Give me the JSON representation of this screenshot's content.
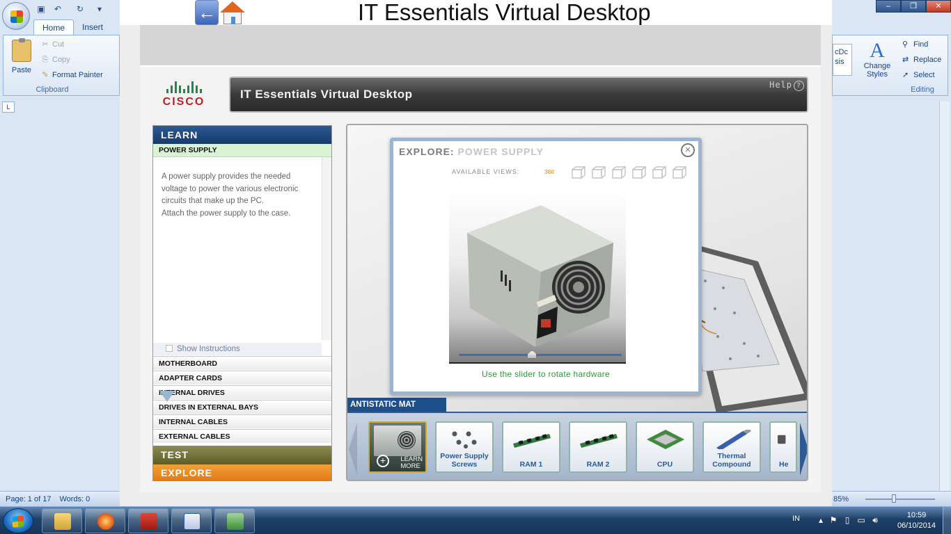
{
  "word": {
    "tabs": [
      "Home",
      "Insert"
    ],
    "paste_label": "Paste",
    "cut_label": "Cut",
    "copy_label": "Copy",
    "format_painter_label": "Format Painter",
    "clipboard_label": "Clipboard",
    "styles_frag_1": "C",
    "styles_frag_2": "I",
    "styles_text_1": "cDc",
    "styles_text_2": "sis",
    "change_styles_label": "Change Styles",
    "find_label": "Find",
    "replace_label": "Replace",
    "select_label": "Select",
    "editing_label": "Editing",
    "ruler_label": "L",
    "status_page": "Page: 1 of 17",
    "status_words": "Words: 0",
    "zoom_level": "85%",
    "window_controls": [
      "–",
      "❐",
      "✕"
    ]
  },
  "app": {
    "window_title": "IT Essentials Virtual Desktop",
    "header_title": "IT Essentials Virtual Desktop",
    "help_label": "Help",
    "cisco_wordmark": "CISCO",
    "learn_label": "LEARN",
    "selected_item": "POWER SUPPLY",
    "description": [
      "A power supply provides the needed",
      "voltage to power the various electronic",
      "circuits that make up the PC.",
      "Attach the power supply to the case."
    ],
    "show_instructions": "Show Instructions",
    "categories": [
      "MOTHERBOARD",
      "ADAPTER CARDS",
      "INTERNAL DRIVES",
      "DRIVES IN EXTERNAL BAYS",
      "INTERNAL CABLES",
      "EXTERNAL CABLES"
    ],
    "test_label": "TEST",
    "explore_label": "EXPLORE",
    "antistatic_label": "ANTISTATIC MAT"
  },
  "popup": {
    "title_a": "EXPLORE:",
    "title_b": "POWER SUPPLY",
    "close_glyph": "×",
    "available_views_label": "AVAILABLE VIEWS:",
    "rotate_label": "360",
    "slider_hint": "Use the slider to rotate hardware",
    "rotation_value": 0.45
  },
  "tray": {
    "items": [
      {
        "label": "LEARN MORE",
        "icon": "power-supply-icon"
      },
      {
        "label": "Power Supply Screws",
        "icon": "screws-icon"
      },
      {
        "label": "RAM 1",
        "icon": "ram-icon"
      },
      {
        "label": "RAM 2",
        "icon": "ram-icon"
      },
      {
        "label": "CPU",
        "icon": "cpu-icon"
      },
      {
        "label": "Thermal Compound",
        "icon": "thermal-compound-icon"
      },
      {
        "label": "He",
        "icon": "heatsink-icon"
      }
    ]
  },
  "taskbar": {
    "lang": "IN",
    "time": "10:59",
    "date": "06/10/2014"
  },
  "colors": {
    "learn_blue": "#1f4f8a",
    "selected_green": "#d8f4d2",
    "explore_orange": "#e88a1f",
    "test_olive": "#7a7a40",
    "hint_green": "#2d9a3a"
  }
}
